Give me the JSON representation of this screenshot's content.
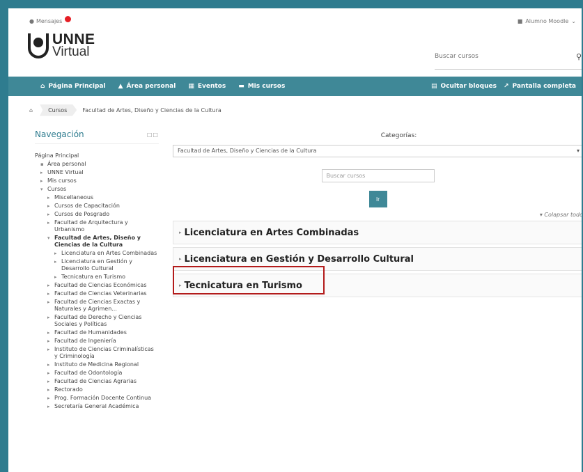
{
  "topbar": {
    "messages": "Mensajes",
    "user": "Alumno Moodle"
  },
  "logo": {
    "line1": "UNNE",
    "line2": "Virtual"
  },
  "search": {
    "placeholder": "Buscar cursos"
  },
  "nav": {
    "items": [
      "Página Principal",
      "Área personal",
      "Eventos",
      "Mis cursos"
    ],
    "right": [
      "Ocultar bloques",
      "Pantalla completa"
    ]
  },
  "breadcrumb": {
    "items": [
      "Cursos",
      "Facultad de Artes, Diseño y Ciencias de la Cultura"
    ]
  },
  "sidebar": {
    "title": "Navegación",
    "items": [
      {
        "label": "Página Principal",
        "level": 1
      },
      {
        "label": "Área personal",
        "level": 2
      },
      {
        "label": "UNNE Virtual",
        "level": 2
      },
      {
        "label": "Mis cursos",
        "level": 2
      },
      {
        "label": "Cursos",
        "level": 2
      },
      {
        "label": "Miscellaneous",
        "level": 3
      },
      {
        "label": "Cursos de Capacitación",
        "level": 3
      },
      {
        "label": "Cursos de Posgrado",
        "level": 3
      },
      {
        "label": "Facultad de Arquitectura y Urbanismo",
        "level": 3
      },
      {
        "label": "Facultad de Artes, Diseño y Ciencias de la Cultura",
        "level": 3
      },
      {
        "label": "Licenciatura en Artes Combinadas",
        "level": 4
      },
      {
        "label": "Licenciatura en Gestión y Desarrollo Cultural",
        "level": 4
      },
      {
        "label": "Tecnicatura en Turismo",
        "level": 4
      },
      {
        "label": "Facultad de Ciencias Económicas",
        "level": 3
      },
      {
        "label": "Facultad de Ciencias Veterinarias",
        "level": 3
      },
      {
        "label": "Facultad de Ciencias Exactas y Naturales y Agrimen...",
        "level": 3
      },
      {
        "label": "Facultad de Derecho y Ciencias Sociales y Políticas",
        "level": 3
      },
      {
        "label": "Facultad de Humanidades",
        "level": 3
      },
      {
        "label": "Facultad de Ingeniería",
        "level": 3
      },
      {
        "label": "Instituto de Ciencias Criminalísticas y Criminología",
        "level": 3
      },
      {
        "label": "Instituto de Medicina Regional",
        "level": 3
      },
      {
        "label": "Facultad de Odontología",
        "level": 3
      },
      {
        "label": "Facultad de Ciencias Agrarias",
        "level": 3
      },
      {
        "label": "Rectorado",
        "level": 3
      },
      {
        "label": "Prog. Formación Docente Continua",
        "level": 3
      },
      {
        "label": "Secretaría General Académica",
        "level": 3
      }
    ]
  },
  "main": {
    "categories_label": "Categorías:",
    "selected_category": "Facultad de Artes, Diseño y Ciencias de la Cultura",
    "search_placeholder": "Buscar cursos",
    "go_button": "Ir",
    "collapse_all": "Colapsar todo",
    "subcategories": [
      "Licenciatura en Artes Combinadas",
      "Licenciatura en Gestión y Desarrollo Cultural",
      "Tecnicatura en Turismo"
    ]
  }
}
